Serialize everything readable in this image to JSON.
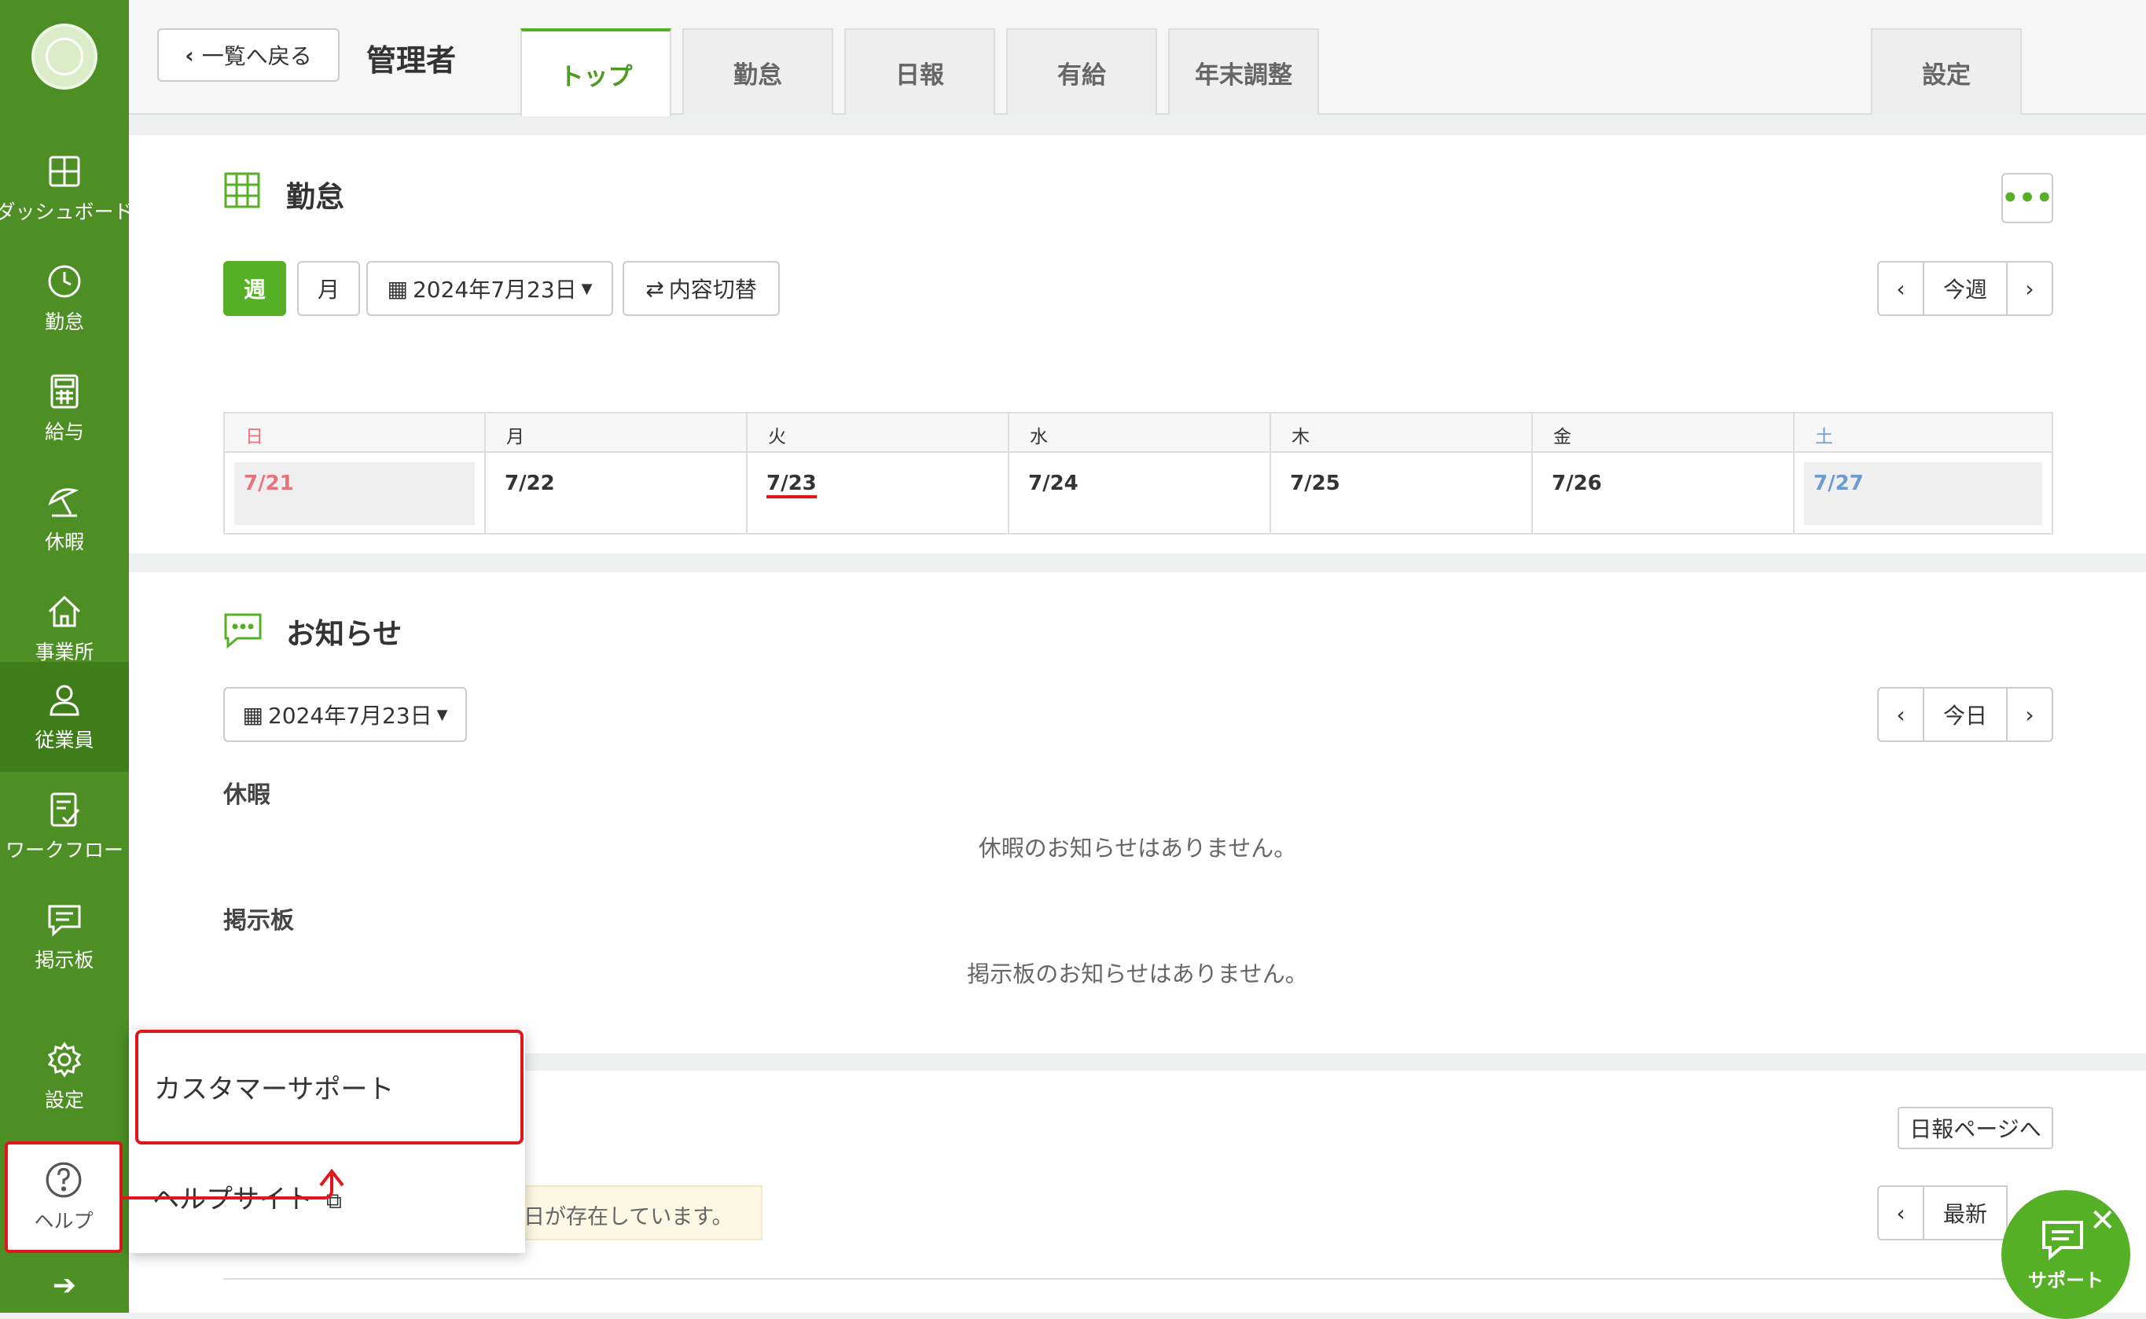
{
  "sidebar": {
    "items": [
      {
        "label": "ダッシュボード",
        "icon": "dashboard-icon"
      },
      {
        "label": "勤怠",
        "icon": "clock-icon"
      },
      {
        "label": "給与",
        "icon": "calculator-icon"
      },
      {
        "label": "休暇",
        "icon": "umbrella-icon"
      },
      {
        "label": "事業所",
        "icon": "home-icon"
      },
      {
        "label": "従業員",
        "icon": "person-icon"
      },
      {
        "label": "ワークフロー",
        "icon": "workflow-icon"
      },
      {
        "label": "掲示板",
        "icon": "message-icon"
      },
      {
        "label": "設定",
        "icon": "gear-icon"
      },
      {
        "label": "ヘルプ",
        "icon": "help-icon"
      }
    ],
    "active_item": "従業員"
  },
  "header": {
    "back_label": "一覧へ戻る",
    "title": "管理者",
    "tabs": [
      {
        "label": "トップ",
        "active": true
      },
      {
        "label": "勤怠"
      },
      {
        "label": "日報"
      },
      {
        "label": "有給"
      },
      {
        "label": "年末調整"
      },
      {
        "label": "設定"
      }
    ]
  },
  "attendance": {
    "title": "勤怠",
    "week_label": "週",
    "month_label": "月",
    "date_label": "2024年7月23日",
    "switch_label": "内容切替",
    "this_week_label": "今週",
    "days": [
      {
        "name": "日",
        "date": "7/21"
      },
      {
        "name": "月",
        "date": "7/22"
      },
      {
        "name": "火",
        "date": "7/23"
      },
      {
        "name": "水",
        "date": "7/24"
      },
      {
        "name": "木",
        "date": "7/25"
      },
      {
        "name": "金",
        "date": "7/26"
      },
      {
        "name": "土",
        "date": "7/27"
      }
    ]
  },
  "notices": {
    "title": "お知らせ",
    "date_label": "2024年7月23日",
    "today_label": "今日",
    "leave_heading": "休暇",
    "leave_empty": "休暇のお知らせはありません。",
    "board_heading": "掲示板",
    "board_empty": "掲示板のお知らせはありません。"
  },
  "daily": {
    "page_link": "日報ページへ",
    "latest_label": "最新",
    "notice_text": "日が存在しています。"
  },
  "help_menu": {
    "customer_support": "カスタマーサポート",
    "help_site": "ヘルプサイト"
  },
  "support_widget": {
    "label": "サポート"
  },
  "colors": {
    "brand_green": "#55b026",
    "sidebar_green": "#4d8f24",
    "highlight_red": "#e0161d",
    "sunday_red": "#e9737b",
    "saturday_blue": "#6b9bd1"
  }
}
